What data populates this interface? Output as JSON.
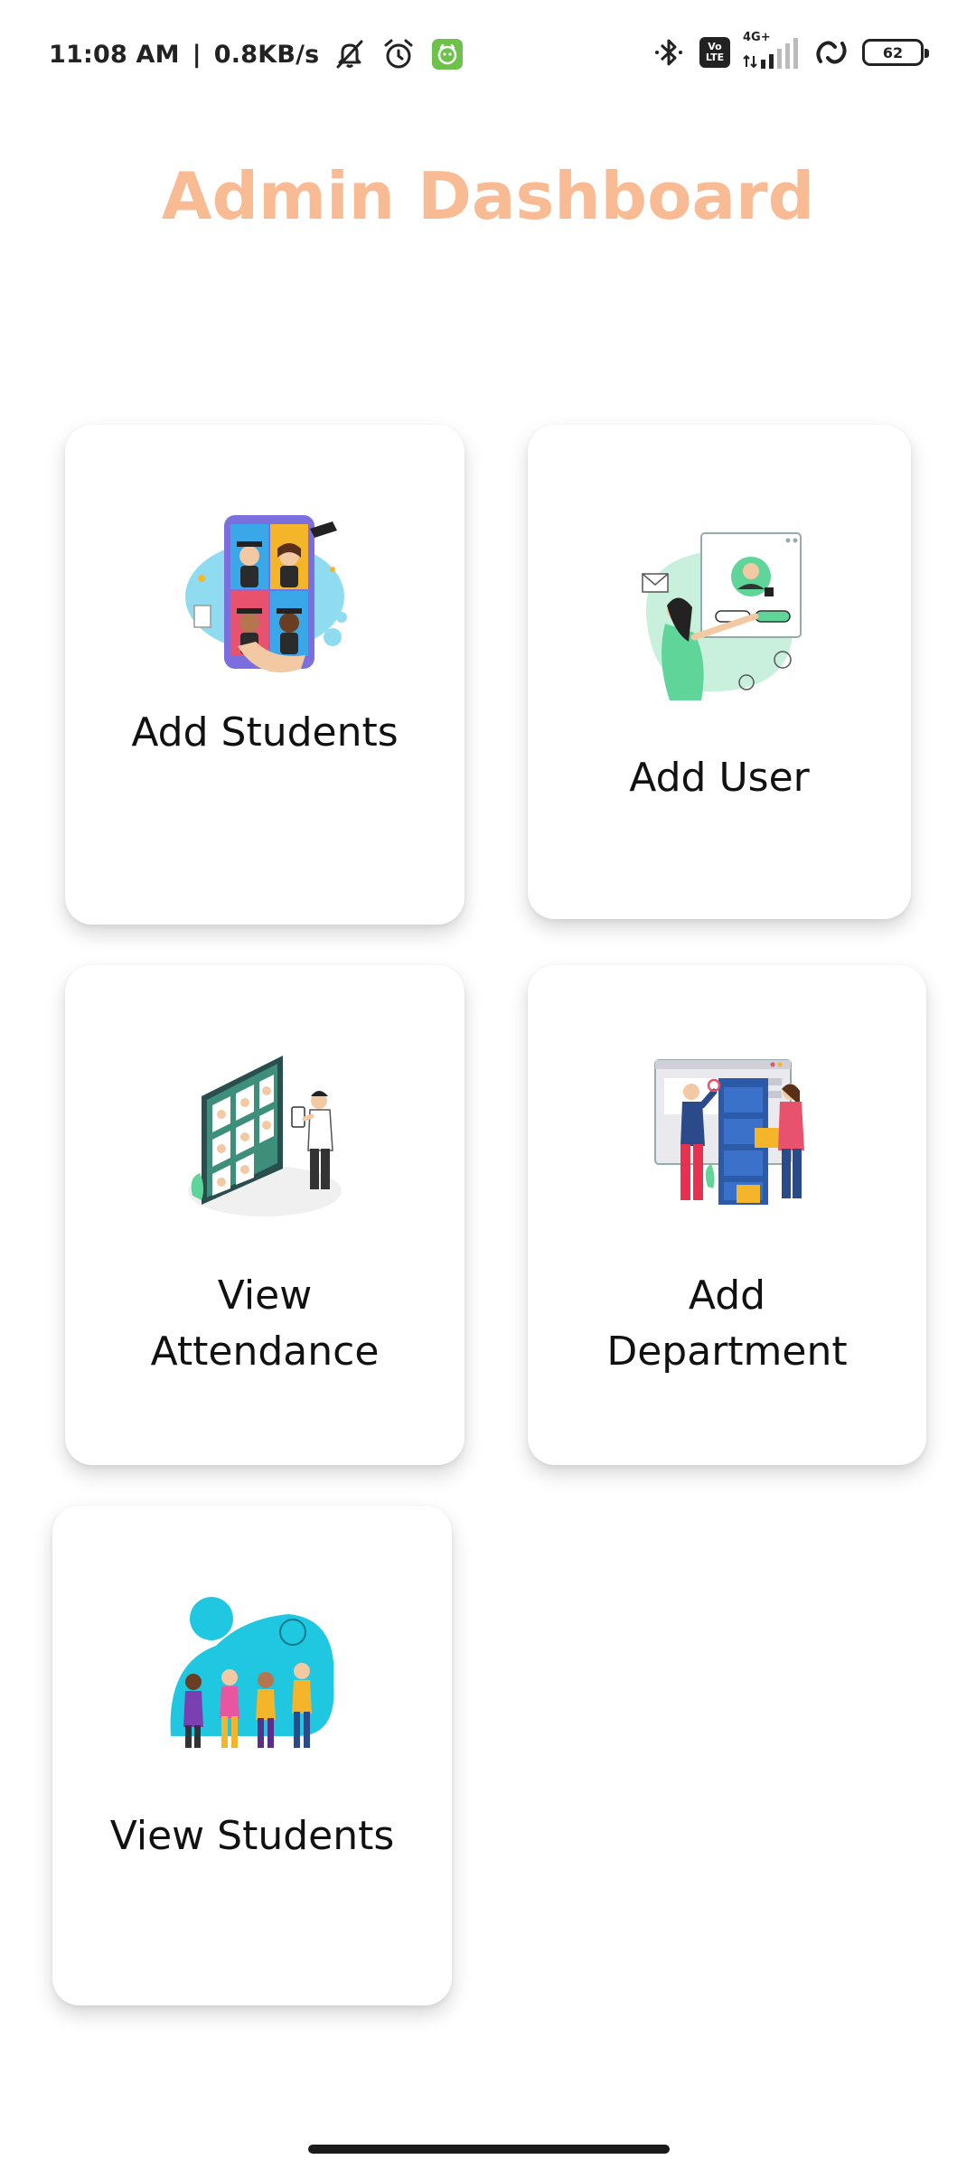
{
  "status_bar": {
    "time": "11:08 AM",
    "separator": "|",
    "network_speed": "0.8KB/s",
    "volte_top": "Vo",
    "volte_bottom": "LTE",
    "network_type": "4G+",
    "battery_level": "62",
    "icons": [
      "mute-icon",
      "alarm-icon",
      "app-notification-icon",
      "bluetooth-icon",
      "volte-icon",
      "signal-icon",
      "hotspot-icon",
      "battery-icon"
    ]
  },
  "header": {
    "title": "Admin Dashboard",
    "title_color": "#f8bb93"
  },
  "cards": [
    {
      "id": "add-students",
      "label": "Add Students",
      "icon": "graduation-students-illustration"
    },
    {
      "id": "add-user",
      "label": "Add User",
      "icon": "user-request-illustration"
    },
    {
      "id": "view-attendance",
      "label": "View Attendance",
      "icon": "attendance-board-illustration"
    },
    {
      "id": "add-department",
      "label": "Add Department",
      "icon": "department-files-illustration"
    },
    {
      "id": "view-students",
      "label": "View Students",
      "icon": "student-group-illustration"
    }
  ],
  "colors": {
    "background": "#ffffff",
    "card_background": "#ffffff",
    "label_text": "#111111"
  }
}
